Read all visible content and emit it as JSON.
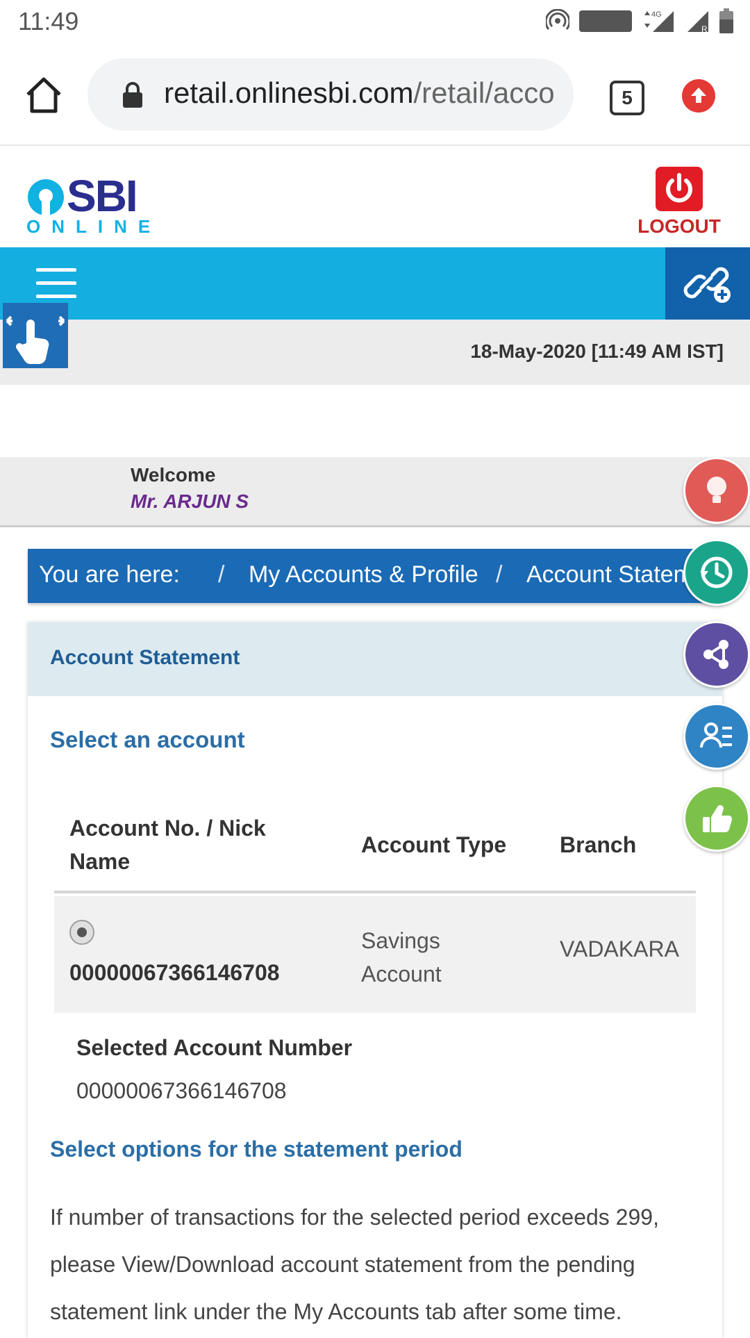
{
  "status_bar": {
    "time": "11:49",
    "network": "4G",
    "volte": "VoLTE",
    "roaming": "R"
  },
  "browser": {
    "url_host": "retail.onlinesbi.com",
    "url_path": "/retail/acco",
    "tab_count": "5"
  },
  "site": {
    "logo_main": "SBI",
    "logo_sub": "ONLINE",
    "logout_label": "LOGOUT",
    "datetime": "18-May-2020 [11:49 AM IST]"
  },
  "welcome": {
    "greeting": "Welcome",
    "user_name": "Mr. ARJUN S"
  },
  "breadcrumb": {
    "prefix": "You are here:",
    "items": [
      "My Accounts & Profile",
      "Account Statement"
    ],
    "separator": "/"
  },
  "panel": {
    "title": "Account Statement",
    "select_account_heading": "Select an account",
    "table": {
      "columns": [
        "Account No. / Nick Name",
        "Account Type",
        "Branch"
      ],
      "rows": [
        {
          "account_no": "00000067366146708",
          "account_type": "Savings Account",
          "branch": "VADAKARA",
          "selected": true
        }
      ]
    },
    "selected_account_label": "Selected Account Number",
    "selected_account_value": "00000067366146708",
    "period_heading": "Select options for the statement period",
    "info_text": "If number of transactions for the selected period exceeds 299, please View/Download account statement from the pending statement link under the My Accounts tab after some time."
  },
  "floating_actions": [
    {
      "name": "tips",
      "color": "#e53935"
    },
    {
      "name": "history",
      "color": "#1aa58a"
    },
    {
      "name": "share",
      "color": "#5e4fa2"
    },
    {
      "name": "profile",
      "color": "#2f84c5"
    },
    {
      "name": "feedback",
      "color": "#7cc24a"
    }
  ],
  "colors": {
    "nav_blue": "#14aee0",
    "breadcrumb_blue": "#1b6ab5",
    "heading_blue": "#2b6ea6",
    "logout_red": "#e11c24"
  }
}
